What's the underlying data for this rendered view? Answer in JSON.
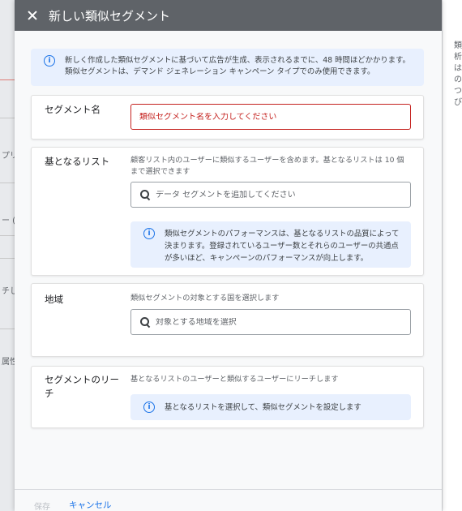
{
  "dialog": {
    "title": "新しい類似セグメント",
    "close_icon": "close-icon"
  },
  "banner": {
    "icon": "info-icon",
    "text": "新しく作成した類似セグメントに基づいて広告が生成、表示されるまでに、48 時間ほどかかります。類似セグメントは、デマンド ジェネレーション キャンペーン タイプでのみ使用できます。"
  },
  "sections": {
    "segment_name": {
      "label": "セグメント名",
      "placeholder": "類似セグメント名を入力してください"
    },
    "base_list": {
      "label": "基となるリスト",
      "description": "顧客リスト内のユーザーに類似するユーザーを含めます。基となるリストは 10 個まで選択できます",
      "search_placeholder": "データ セグメントを追加してください",
      "info_text": "類似セグメントのパフォーマンスは、基となるリストの品質によって決まります。登録されているユーザー数とそれらのユーザーの共通点が多いほど、キャンペーンのパフォーマンスが向上します。"
    },
    "region": {
      "label": "地域",
      "description": "類似セグメントの対象とする国を選択します",
      "search_placeholder": "対象とする地域を選択"
    },
    "reach": {
      "label": "セグメントのリーチ",
      "description": "基となるリストのユーザーと類似するユーザーにリーチします",
      "info_text": "基となるリストを選択して、類似セグメントを設定します"
    }
  },
  "footer": {
    "save_label": "保存",
    "cancel_label": "キャンセル"
  },
  "background": {
    "left_fragments": [
      "プリ",
      "ー (",
      "チし",
      "属性"
    ],
    "right_fragments": [
      "類",
      "析",
      "は",
      "の",
      "つ",
      "び"
    ]
  },
  "colors": {
    "header_bg": "#5f6368",
    "accent": "#1a73e8",
    "error": "#c5221f",
    "info_bg": "#e8f0fe"
  }
}
